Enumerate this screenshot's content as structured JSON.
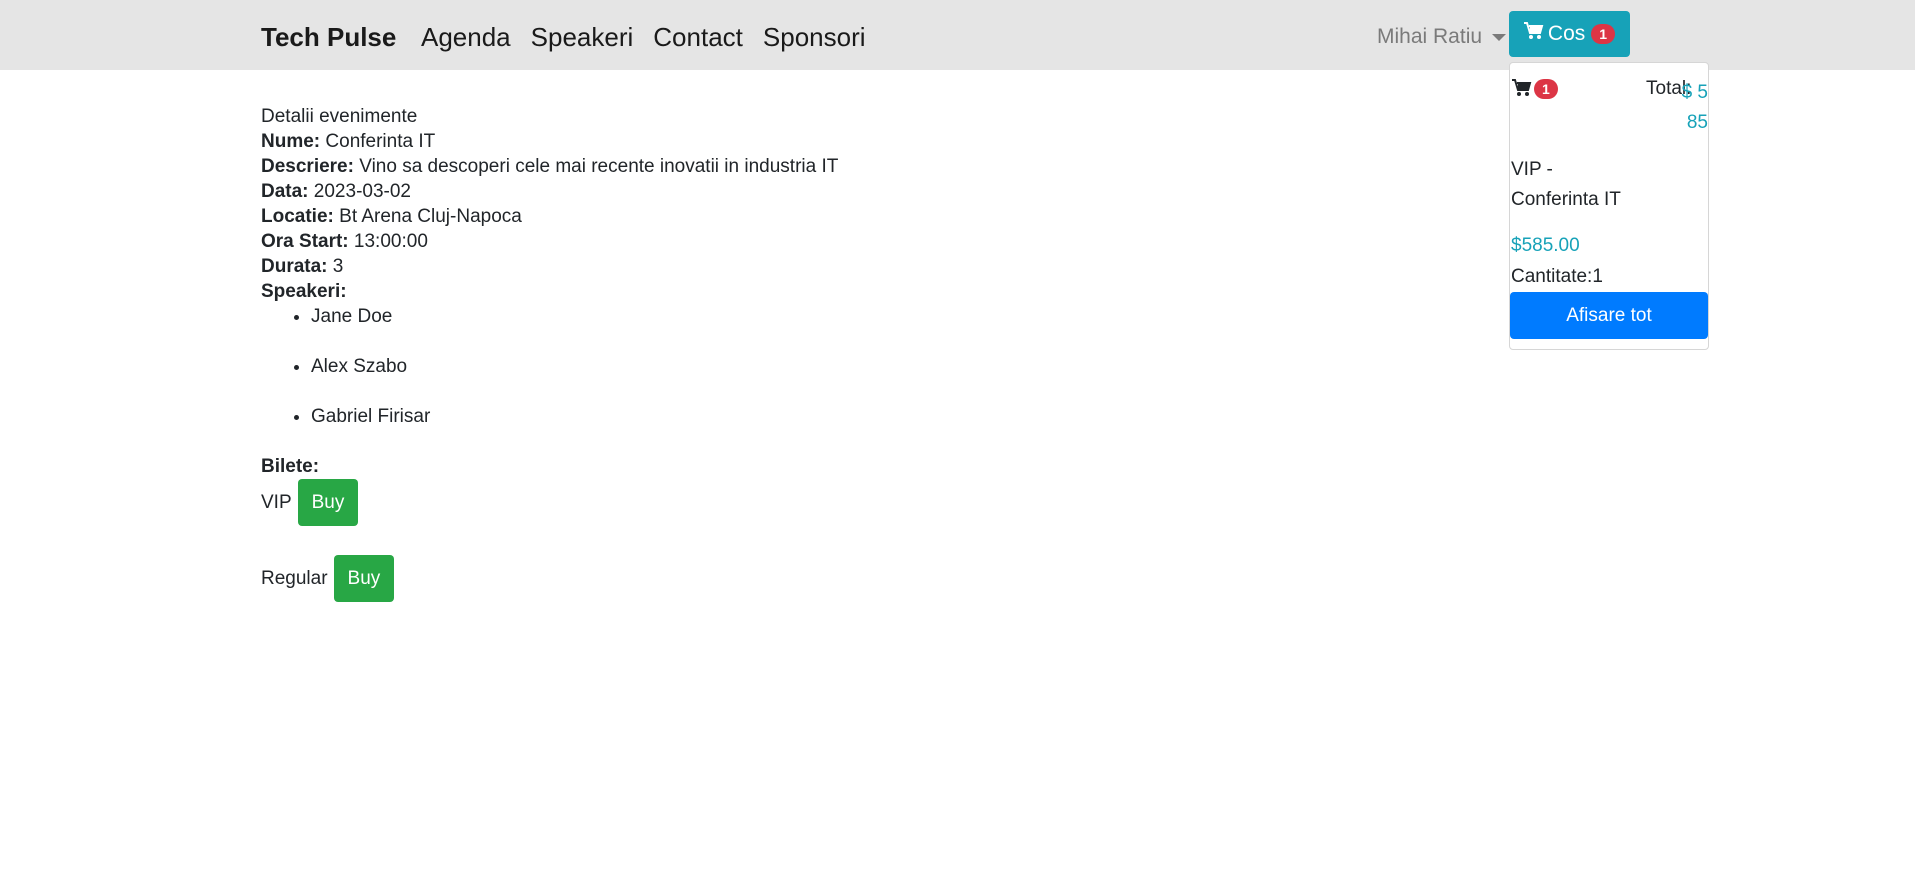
{
  "navbar": {
    "brand": "Tech Pulse",
    "links": [
      "Agenda",
      "Speakeri",
      "Contact",
      "Sponsori"
    ],
    "user": "Mihai Ratiu",
    "cart_label": "Cos",
    "cart_count": "1"
  },
  "cart_dropdown": {
    "count": "1",
    "total_label": "Total:",
    "total_value": "$ 585",
    "item_name": "VIP - Conferinta IT",
    "item_price": "$585.00",
    "item_qty": "Cantitate:1",
    "show_all": "Afisare tot"
  },
  "event": {
    "heading": "Detalii evenimente",
    "fields": [
      {
        "label": "Nume:",
        "value": "Conferinta IT"
      },
      {
        "label": "Descriere:",
        "value": "Vino sa descoperi cele mai recente inovatii in industria IT"
      },
      {
        "label": "Data:",
        "value": "2023-03-02"
      },
      {
        "label": "Locatie:",
        "value": "Bt Arena Cluj-Napoca"
      },
      {
        "label": "Ora Start:",
        "value": "13:00:00"
      },
      {
        "label": "Durata:",
        "value": "3"
      }
    ],
    "speakers_label": "Speakeri:",
    "speakers": [
      "Jane Doe",
      "Alex Szabo",
      "Gabriel Firisar"
    ],
    "tickets_label": "Bilete:",
    "tickets": [
      {
        "type": "VIP",
        "button": "Buy"
      },
      {
        "type": "Regular",
        "button": "Buy"
      }
    ]
  },
  "colors": {
    "navbar_bg": "#e5e5e5",
    "cart_button": "#17a2b8",
    "badge": "#dc3545",
    "primary": "#007bff",
    "success": "#28a745"
  },
  "icons": {
    "cart": "shopping-cart-icon",
    "caret": "caret-down-icon"
  }
}
